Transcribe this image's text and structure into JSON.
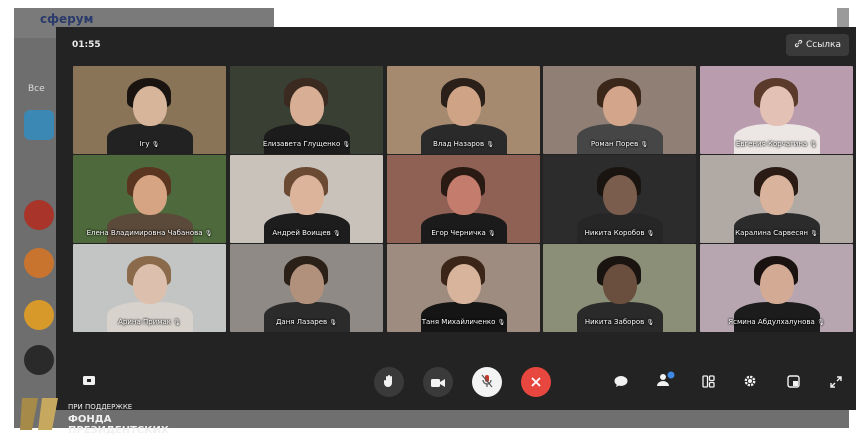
{
  "background": {
    "brand": "сферум",
    "filter_label": "Все"
  },
  "call": {
    "timer": "01:55",
    "link_button": "Ссылка"
  },
  "participants": [
    {
      "name": "Ігу",
      "wall": "#8a7458",
      "face": "#d7b59a",
      "hair": "#1a1410",
      "body": "#222222"
    },
    {
      "name": "Елизавета Глущенко",
      "wall": "#3a3f33",
      "face": "#d8ae94",
      "hair": "#3a2a1f",
      "body": "#1c1c1c"
    },
    {
      "name": "Влад Назаров",
      "wall": "#a58a6f",
      "face": "#cfa386",
      "hair": "#2b2019",
      "body": "#2a2a2a"
    },
    {
      "name": "Роман Порев",
      "wall": "#8f7f75",
      "face": "#d3a68b",
      "hair": "#3b261a",
      "body": "#464646"
    },
    {
      "name": "Евгения Корчагина",
      "wall": "#b99cae",
      "face": "#e3c1b4",
      "hair": "#5a3a2a",
      "body": "#ece6e4"
    },
    {
      "name": "Елена Владимировна Чабанова",
      "wall": "#4e6a3c",
      "face": "#d6a482",
      "hair": "#5a3520",
      "body": "#5b4a3a"
    },
    {
      "name": "Андрей Воищев",
      "wall": "#c9c2bb",
      "face": "#dcb49b",
      "hair": "#6b4a33",
      "body": "#1d1d1d"
    },
    {
      "name": "Егор Черничка",
      "wall": "#8e6154",
      "face": "#c47c6c",
      "hair": "#2a1a14",
      "body": "#1b1b1b"
    },
    {
      "name": "Никита Коробов",
      "wall": "#2c2c2c",
      "face": "#7a5d4c",
      "hair": "#1a1410",
      "body": "#262626"
    },
    {
      "name": "Каралина Сарвесян",
      "wall": "#b1aaa4",
      "face": "#d9b39b",
      "hair": "#2a1c15",
      "body": "#2b2b2b"
    },
    {
      "name": "Арина Примак",
      "wall": "#c2c5c4",
      "face": "#dcc0ad",
      "hair": "#8a6a4a",
      "body": "#d8d2cc"
    },
    {
      "name": "Даня Лазарев",
      "wall": "#8f8a85",
      "face": "#b2917c",
      "hair": "#2a2018",
      "body": "#2b2b2b"
    },
    {
      "name": "Таня Михайличенко",
      "wall": "#9e8c80",
      "face": "#d8b49c",
      "hair": "#3a2518",
      "body": "#151515"
    },
    {
      "name": "Никита Заборов",
      "wall": "#8b8f77",
      "face": "#6a4e3e",
      "hair": "#1a1410",
      "body": "#2a2a2a"
    },
    {
      "name": "Ясмина Абдулхалунова",
      "wall": "#b7a6b0",
      "face": "#d3ab95",
      "hair": "#1a1210",
      "body": "#1c1c1c"
    }
  ],
  "controls": {
    "screen_share_icon": "screen-share-icon",
    "raise_hand_icon": "raise-hand-icon",
    "camera_icon": "camera-icon",
    "mic_icon": "microphone-muted-icon",
    "end_call_icon": "end-call-icon",
    "chat_icon": "chat-icon",
    "participants_icon": "participants-icon",
    "layout_icon": "layout-icon",
    "settings_icon": "settings-icon",
    "pip_icon": "picture-in-picture-icon",
    "fullscreen_icon": "fullscreen-icon",
    "end_call_color": "#e8473f",
    "mic_button_color": "#f3f3f3"
  },
  "footer": {
    "line1": "ПРИ ПОДДЕРЖКЕ",
    "line2": "ФОНДА",
    "line3": "ПРЕЗИДЕНТСКИХ"
  }
}
